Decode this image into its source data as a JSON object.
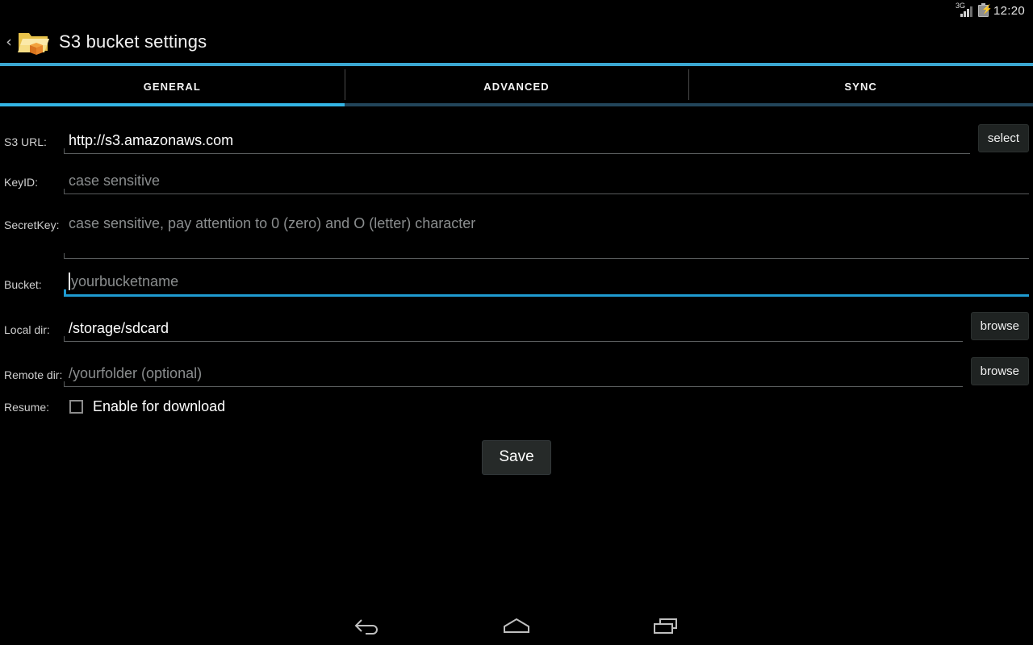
{
  "statusbar": {
    "network": "3G",
    "network_icon": "signal-bars-icon",
    "battery_icon": "battery-charging-icon",
    "clock": "12:20"
  },
  "header": {
    "back_icon": "back-chevron-icon",
    "app_icon": "folder-box-icon",
    "title": "S3 bucket settings",
    "accent_color": "#3ba7d1"
  },
  "tabs": {
    "active_index": 0,
    "active_underline_color": "#33b5e5",
    "inactive_underline_color": "#22455a",
    "items": [
      {
        "label": "GENERAL"
      },
      {
        "label": "ADVANCED"
      },
      {
        "label": "SYNC"
      }
    ]
  },
  "form": {
    "fields": [
      {
        "label": "S3 URL:",
        "value": "http://s3.amazonaws.com",
        "placeholder": "",
        "button": "select",
        "focused": false
      },
      {
        "label": "KeyID:",
        "value": "",
        "placeholder": "case sensitive",
        "button": "",
        "focused": false
      },
      {
        "label": "SecretKey:",
        "value": "",
        "placeholder": "case sensitive, pay attention to 0 (zero) and O (letter) character",
        "button": "",
        "focused": false
      },
      {
        "label": "Bucket:",
        "value": "",
        "placeholder": "yourbucketname",
        "button": "",
        "focused": true
      },
      {
        "label": "Local dir:",
        "value": "/storage/sdcard",
        "placeholder": "",
        "button": "browse",
        "focused": false
      },
      {
        "label": "Remote dir:",
        "value": "",
        "placeholder": "/yourfolder (optional)",
        "button": "browse",
        "focused": false
      }
    ],
    "resume": {
      "label": "Resume:",
      "checkbox_label": "Enable for download",
      "checked": false
    },
    "save_label": "Save"
  },
  "navbar": {
    "back_icon": "nav-back-icon",
    "home_icon": "nav-home-icon",
    "recents_icon": "nav-recents-icon"
  }
}
